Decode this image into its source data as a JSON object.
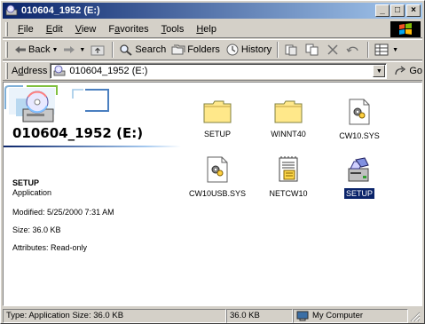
{
  "window": {
    "title": "010604_1952 (E:)",
    "controls": {
      "minimize": "_",
      "maximize": "□",
      "close": "×"
    }
  },
  "menubar": {
    "items": [
      {
        "label": "File",
        "key": "F",
        "rest": "ile"
      },
      {
        "label": "Edit",
        "key": "E",
        "rest": "dit"
      },
      {
        "label": "View",
        "key": "V",
        "rest": "iew"
      },
      {
        "label": "Favorites",
        "pre": "F",
        "key": "a",
        "rest": "vorites"
      },
      {
        "label": "Tools",
        "key": "T",
        "rest": "ools"
      },
      {
        "label": "Help",
        "key": "H",
        "rest": "elp"
      }
    ]
  },
  "toolbar": {
    "back_label": "Back",
    "search_label": "Search",
    "folders_label": "Folders",
    "history_label": "History"
  },
  "addressbar": {
    "label_key": "d",
    "label_pre": "A",
    "label_rest": "dress",
    "value": "010604_1952 (E:)",
    "go_label": "Go"
  },
  "left_pane": {
    "drive_title": "010604_1952 (E:)",
    "selected_name": "SETUP",
    "selected_type": "Application",
    "modified": "Modified: 5/25/2000 7:31 AM",
    "size": "Size: 36.0 KB",
    "attributes": "Attributes: Read-only"
  },
  "files": [
    {
      "name": "SETUP",
      "kind": "folder"
    },
    {
      "name": "WINNT40",
      "kind": "folder"
    },
    {
      "name": "CW10.SYS",
      "kind": "sys"
    },
    {
      "name": "CW10USB.SYS",
      "kind": "sys"
    },
    {
      "name": "NETCW10",
      "kind": "inf"
    },
    {
      "name": "SETUP",
      "kind": "app",
      "selected": true
    }
  ],
  "statusbar": {
    "info": "Type: Application Size: 36.0 KB",
    "size": "36.0 KB",
    "zone": "My Computer"
  }
}
